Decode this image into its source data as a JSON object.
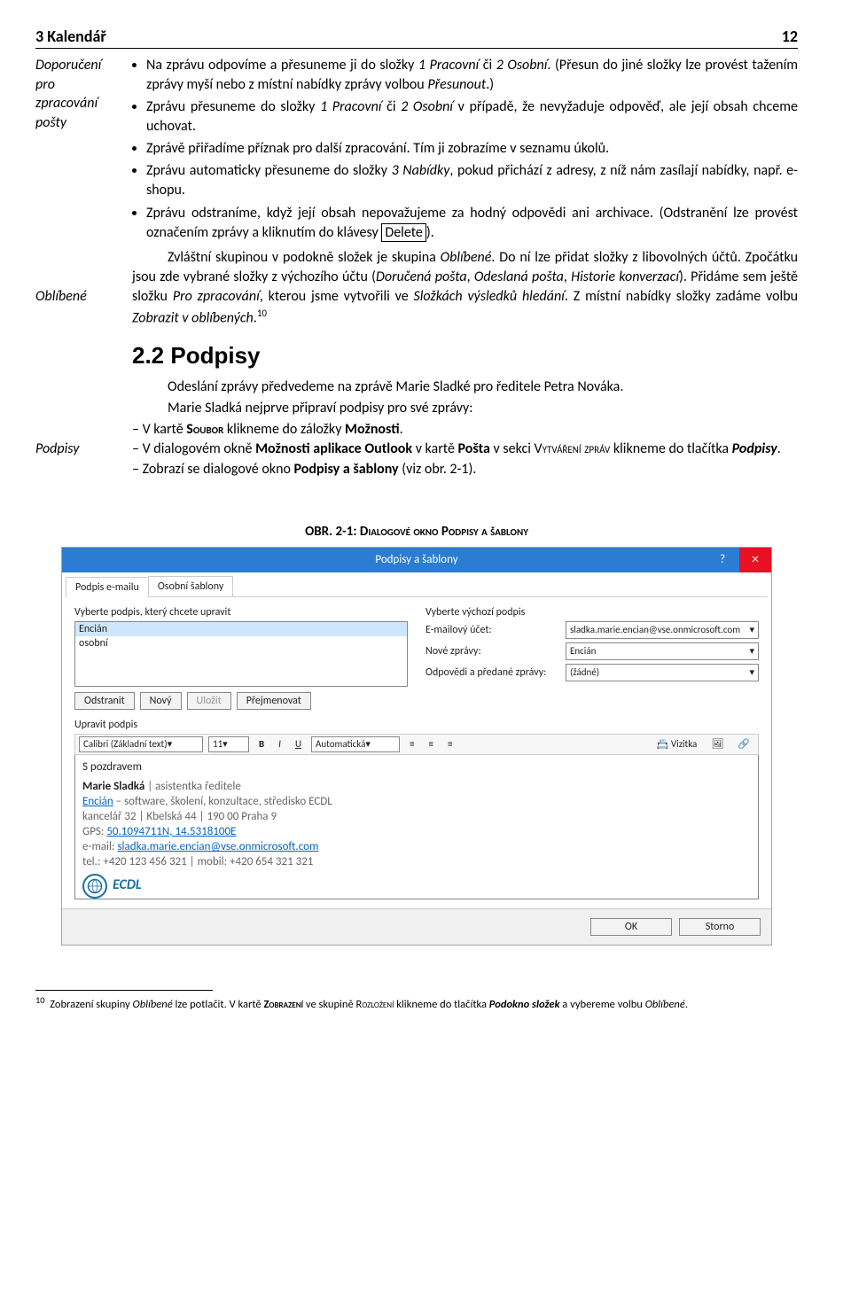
{
  "header": {
    "left": "3 Kalendář",
    "right": "12"
  },
  "margins": {
    "m1a": "Doporučení",
    "m1b": "pro",
    "m1c": "zpracování",
    "m1d": "pošty",
    "m2": "Oblíbené",
    "m3": "Podpisy"
  },
  "bullets": {
    "b1a": "Na zprávu odpovíme a přesuneme ji do složky ",
    "b1b": "1 Pracovní",
    "b1c": " či ",
    "b1d": "2 Osobní",
    "b1e": ". (Přesun do jiné složky lze provést tažením zprávy myší nebo z místní nabídky zprávy volbou ",
    "b1f": "Přesunout",
    "b1g": ".)",
    "b2a": "Zprávu přesuneme do složky ",
    "b2b": "1 Pracovní",
    "b2c": " či ",
    "b2d": "2 Osobní",
    "b2e": " v případě, že nevyžaduje odpověď, ale její obsah chceme uchovat.",
    "b3": "Zprávě přiřadíme příznak pro další zpracování. Tím ji zobrazíme v seznamu úkolů.",
    "b4a": "Zprávu automaticky přesuneme do složky ",
    "b4b": "3 Nabídky",
    "b4c": ", pokud přichází z adresy, z níž nám zasílají nabídky, např. e-shopu.",
    "b5a": "Zprávu odstraníme, když její obsah nepovažujeme za hodný odpovědi ani archivace. (Odstranění lze provést označením zprávy a kliknutím do klávesy ",
    "b5b": "Delete",
    "b5c": ")."
  },
  "para1": {
    "p1a": "Zvláštní skupinou v podokně složek je skupina ",
    "p1b": "Oblíbené",
    "p1c": ". Do ní lze přidat složky z libovolných účtů. Zpočátku jsou zde vybrané složky z výchozího účtu (",
    "p1d": "Doručená pošta",
    "p1e": ", ",
    "p1f": "Odeslaná pošta",
    "p1g": ", ",
    "p1h": "Historie konverzací",
    "p1i": "). Přidáme sem ještě složku ",
    "p1j": "Pro zpracování",
    "p1k": ", kterou jsme vytvořili ve ",
    "p1l": "Složkách výsledků hledání",
    "p1m": ". Z místní nabídky složky zadáme volbu ",
    "p1n": "Zobrazit v oblíbených",
    "p1o": "."
  },
  "sec": {
    "num": "2.2",
    "title": "Podpisy"
  },
  "para2": "Odeslání zprávy předvedeme na zprávě Marie Sladké pro ředitele Petra Nováka.",
  "para3": "Marie Sladká nejprve připraví podpisy pro své zprávy:",
  "steps": {
    "s1a": "V kartě ",
    "s1b": "Soubor",
    "s1c": " klikneme do záložky ",
    "s1d": "Možnosti",
    "s1e": ".",
    "s2a": "V dialogovém okně ",
    "s2b": "Možnosti aplikace Outlook",
    "s2c": " v kartě ",
    "s2d": "Pošta",
    "s2e": " v sekci ",
    "s2f": "Vytváření zpráv",
    "s2g": " klikneme do tlačítka ",
    "s2h": "Podpisy",
    "s2i": ".",
    "s3a": "Zobrazí se dialogové okno ",
    "s3b": "Podpisy a šablony",
    "s3c": " (viz obr. 2-1)."
  },
  "caption": "OBR. 2-1: Dialogové okno Podpisy a šablony",
  "dialog": {
    "title": "Podpisy a šablony",
    "tab1": "Podpis e-mailu",
    "tab2": "Osobní šablony",
    "chooseLabel": "Vyberte podpis, který chcete upravit",
    "listItem1": "Encián",
    "listItem2": "osobní",
    "defaultLabel": "Vyberte výchozí podpis",
    "accountLabel": "E-mailový účet:",
    "accountValue": "sladka.marie.encian@vse.onmicrosoft.com",
    "newMsgLabel": "Nové zprávy:",
    "newMsgValue": "Encián",
    "replyLabel": "Odpovědi a předané zprávy:",
    "replyValue": "(žádné)",
    "btnDelete": "Odstranit",
    "btnNew": "Nový",
    "btnSave": "Uložit",
    "btnRename": "Přejmenovat",
    "editLabel": "Upravit podpis",
    "font": "Calibri (Základní text)",
    "size": "11",
    "auto": "Automatická",
    "vizitka": "Vizitka",
    "sigLine1": "S pozdravem",
    "sigName": "Marie Sladká",
    "sigRole": " | asistentka ředitele",
    "sigLine2a": "Encián",
    "sigLine2b": " – software, školení, konzultace, středisko ECDL",
    "sigLine3": "kancelář 32 | Kbelská 44 | 190 00 Praha 9",
    "sigGpsLabel": "GPS: ",
    "sigGps": "50.1094711N, 14.5318100E",
    "sigMailLabel": "e-mail: ",
    "sigMail": "sladka.marie.encian@vse.onmicrosoft.com",
    "sigTel": "tel.: +420 123 456 321 | mobil: +420 654 321 321",
    "ecdl": "ECDL",
    "ok": "OK",
    "cancel": "Storno"
  },
  "footnote": {
    "num": "10",
    "t1": "Zobrazení skupiny ",
    "t2": "Oblíbené",
    "t3": " lze potlačit. V kartě ",
    "t4": "Zobrazení",
    "t5": " ve skupině ",
    "t6": "Rozložení",
    "t7": " klikneme do tlačítka ",
    "t8": "Podokno složek",
    "t9": " a vybereme volbu ",
    "t10": "Oblíbené",
    "t11": "."
  }
}
